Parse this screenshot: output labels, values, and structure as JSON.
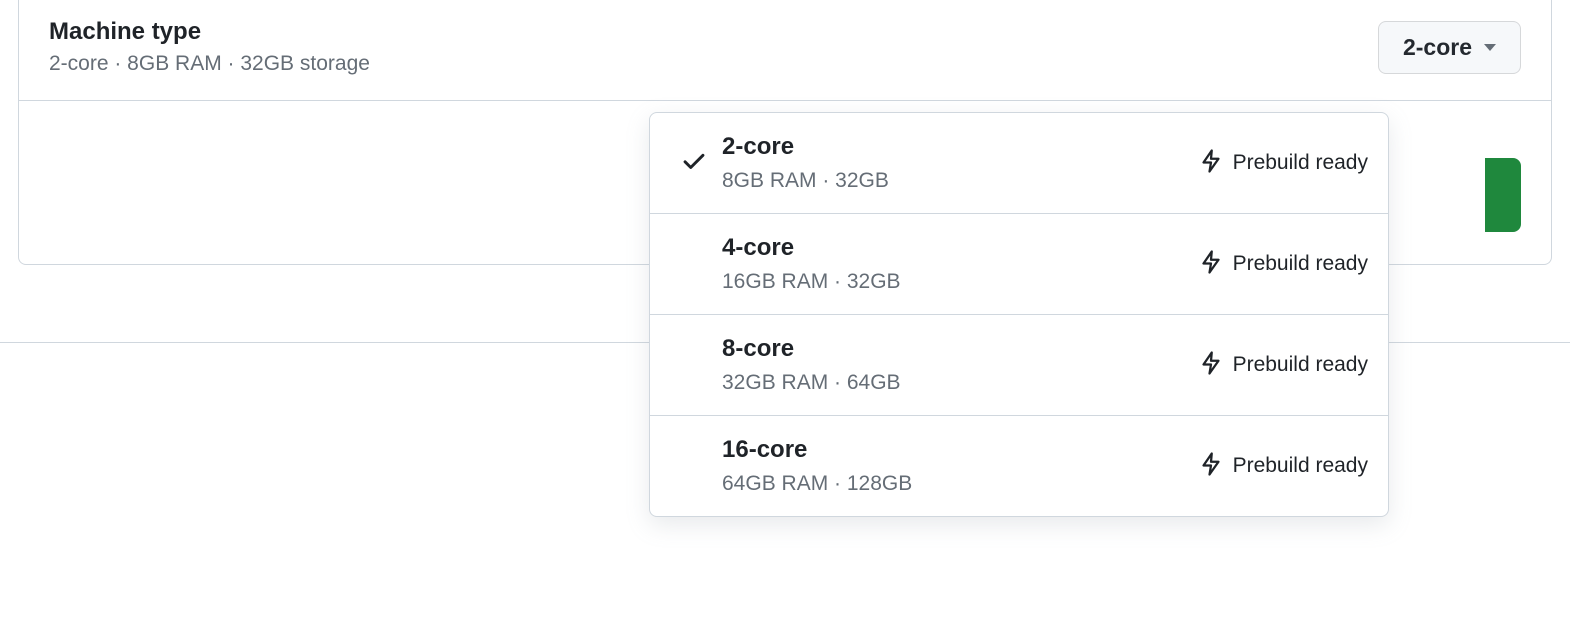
{
  "section": {
    "title": "Machine type",
    "subtitle": "2-core · 8GB RAM · 32GB storage"
  },
  "dropdown": {
    "selected_label": "2-core"
  },
  "options": [
    {
      "title": "2-core",
      "subtitle": "8GB RAM · 32GB",
      "badge": "Prebuild ready",
      "selected": true
    },
    {
      "title": "4-core",
      "subtitle": "16GB RAM · 32GB",
      "badge": "Prebuild ready",
      "selected": false
    },
    {
      "title": "8-core",
      "subtitle": "32GB RAM · 64GB",
      "badge": "Prebuild ready",
      "selected": false
    },
    {
      "title": "16-core",
      "subtitle": "64GB RAM · 128GB",
      "badge": "Prebuild ready",
      "selected": false
    }
  ]
}
